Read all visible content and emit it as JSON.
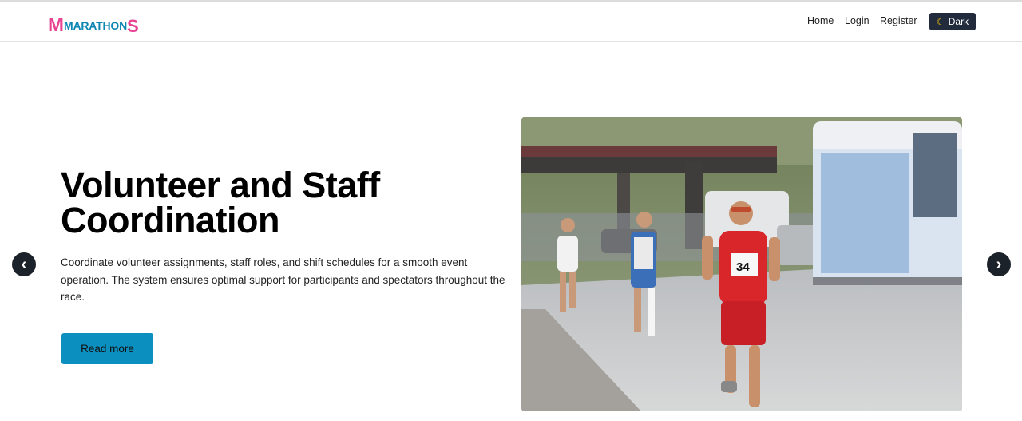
{
  "header": {
    "logo": {
      "first": "M",
      "middle": "MARATHON",
      "last": "S"
    },
    "nav": [
      {
        "label": "Home"
      },
      {
        "label": "Login"
      },
      {
        "label": "Register"
      }
    ],
    "theme_button": {
      "icon": "moon-icon",
      "label": "Dark"
    }
  },
  "slide": {
    "title": "Volunteer and Staff Coordination",
    "description": "Coordinate volunteer assignments, staff roles, and shift schedules for a smooth event operation. The system ensures optimal support for participants and spectators throughout the race.",
    "button_label": "Read more",
    "image": {
      "runner_bib": "34"
    }
  },
  "carousel": {
    "prev_icon": "‹",
    "next_icon": "›"
  },
  "colors": {
    "brand_pink": "#e84393",
    "brand_blue": "#0e86b4",
    "button_blue": "#0b8fbf",
    "dark_button": "#212b3b"
  }
}
